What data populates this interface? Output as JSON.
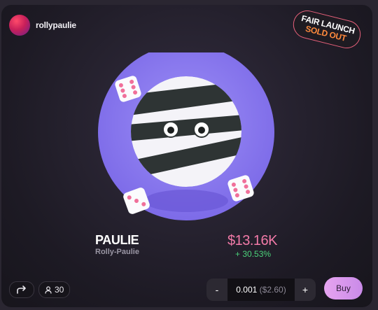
{
  "creator": {
    "username": "rollypaulie"
  },
  "badge": {
    "line1": "FAIR LAUNCH",
    "line2": "SOLD OUT"
  },
  "token": {
    "name": "PAULIE",
    "subtitle": "Rolly-Paulie"
  },
  "market": {
    "price": "$13.16K",
    "change": "+ 30.53%"
  },
  "actions": {
    "holders_count": "30",
    "qty_minus": "-",
    "qty_value": "0.001",
    "qty_usd": "($2.60)",
    "qty_plus": "+",
    "buy_label": "Buy"
  },
  "colors": {
    "price": "#f27aa8",
    "change_positive": "#4bd27a",
    "badge_sold_out": "#ff8a3d",
    "circle_bg": "#8c7cf0",
    "buy_button": "#d896ec"
  },
  "icons": {
    "share": "share-arrow-icon",
    "holders": "user-icon",
    "art": "mummy-ball-with-dice"
  }
}
